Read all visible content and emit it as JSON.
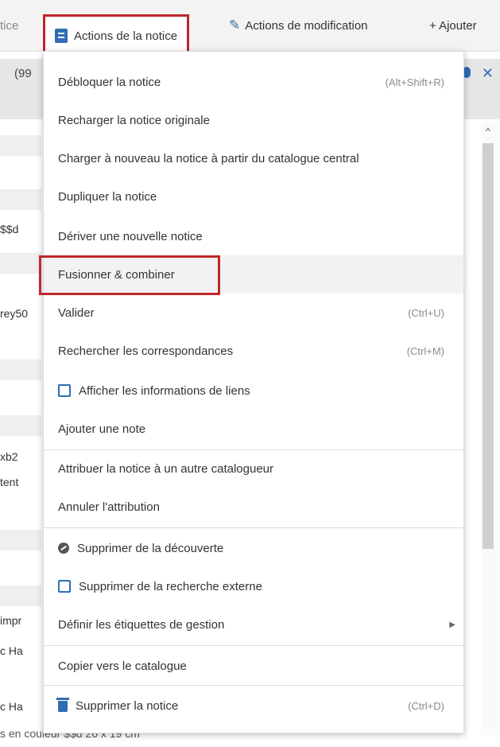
{
  "toolbar": {
    "partial_left": "tice",
    "actions_notice": "Actions de la notice",
    "actions_modification": "Actions de modification",
    "add": "+ Ajouter",
    "colors": {
      "accent": "#2f6eb5",
      "highlight_border": "#c0262c"
    }
  },
  "background": {
    "bar_text": "(99",
    "left_texts": [
      "$$d",
      "rey50",
      "xb2",
      "tent",
      "impr",
      "c Ha",
      "c Ha"
    ],
    "bottom_text": "s en couleur $$d 26 x 19 cm"
  },
  "menu": {
    "items": [
      {
        "label": "Débloquer la notice",
        "shortcut": "(Alt+Shift+R)"
      },
      {
        "label": "Recharger la notice originale"
      },
      {
        "label": "Charger à nouveau la notice à partir du catalogue central"
      },
      {
        "label": "Dupliquer la notice"
      },
      {
        "label": "Dériver une nouvelle notice"
      },
      {
        "label": "Fusionner & combiner"
      },
      {
        "label": "Valider",
        "shortcut": "(Ctrl+U)"
      },
      {
        "label": "Rechercher les correspondances",
        "shortcut": "(Ctrl+M)"
      },
      {
        "label": "Afficher les informations de liens"
      },
      {
        "label": "Ajouter une note"
      },
      {
        "label": "Attribuer la notice à un autre catalogueur"
      },
      {
        "label": "Annuler l'attribution"
      },
      {
        "label": "Supprimer de la découverte"
      },
      {
        "label": "Supprimer de la recherche externe"
      },
      {
        "label": "Définir les étiquettes de gestion"
      },
      {
        "label": "Copier vers le catalogue"
      },
      {
        "label": "Supprimer la notice",
        "shortcut": "(Ctrl+D)"
      }
    ]
  }
}
